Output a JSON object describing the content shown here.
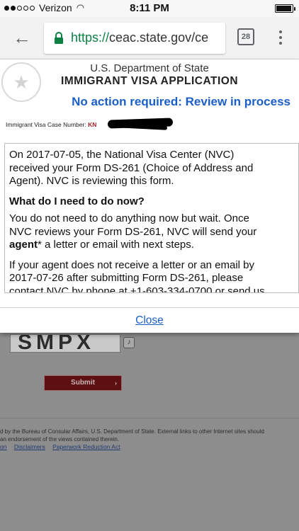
{
  "status_bar": {
    "carrier": "Verizon",
    "time": "8:11 PM",
    "signal_bars_filled": 2,
    "signal_bars_total": 5,
    "battery_level": 0.95
  },
  "browser": {
    "url_scheme": "https://",
    "url_host": "ceac.state.gov/ce",
    "tab_count": "28",
    "icons": [
      "back-arrow-icon",
      "lock-icon",
      "tabs-icon",
      "overflow-menu-icon"
    ]
  },
  "modal": {
    "department": "U.S. Department of State",
    "title": "IMMIGRANT VISA APPLICATION",
    "status": "No action required: Review in process",
    "case_label": "Immigrant Visa Case Number:",
    "case_number_visible": "KN",
    "intro": [
      "On 2017-07-05, the National Visa Center (NVC)",
      "received your Form DS-261 (Choice of Address and",
      "Agent). NVC is reviewing this form."
    ],
    "heading": "What do I need to do now?",
    "wait_lines": [
      "You do not need to do anything now but wait. Once",
      "NVC reviews your Form DS-261, NVC will send your"
    ],
    "agent_word": "agent",
    "agent_rest": "* a letter or email with next steps.",
    "contact": [
      "If your agent does not receive a letter or an email by",
      "2017-07-26 after submitting Form DS-261, please",
      "contact NVC by phone at +1-603-334-0700 or send us"
    ],
    "close_label": "Close"
  },
  "background_page": {
    "captcha_text": "SMPX",
    "submit_label": "Submit",
    "footer_text": "d by the Bureau of Consular Affairs, U.S. Department of State. External links to other Internet sites should",
    "footer_text2": "an endorsement of the views contained therein.",
    "footer_links": [
      "on",
      "Disclaimers",
      "Paperwork Reduction Act"
    ]
  },
  "colors": {
    "status_blue": "#1a5fc9",
    "url_green": "#0b8043",
    "submit_maroon": "#5e0f12"
  }
}
